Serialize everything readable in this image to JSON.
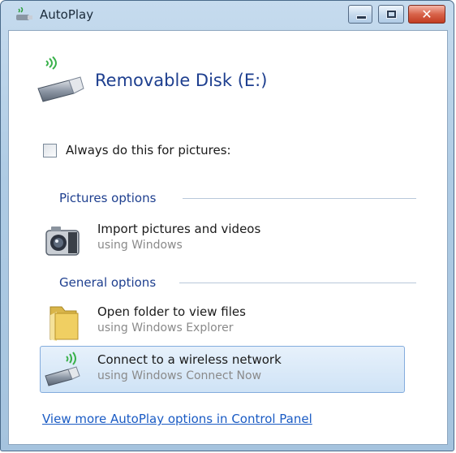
{
  "window": {
    "title": "AutoPlay",
    "controls": {
      "minimize_icon": "minimize-icon",
      "maximize_icon": "maximize-icon",
      "close_glyph": "✕"
    }
  },
  "device": {
    "name": "Removable Disk (E:)",
    "icon": "usb-wireless-drive-icon"
  },
  "always_checkbox": {
    "label": "Always do this for pictures:",
    "checked": false
  },
  "sections": {
    "pictures": {
      "label": "Pictures options",
      "options": [
        {
          "title": "Import pictures and videos",
          "subtitle": "using Windows",
          "icon": "camera-icon"
        }
      ]
    },
    "general": {
      "label": "General options",
      "options": [
        {
          "title": "Open folder to view files",
          "subtitle": "using Windows Explorer",
          "icon": "folder-icon"
        },
        {
          "title": "Connect to a wireless network",
          "subtitle": "using Windows Connect Now",
          "icon": "wireless-usb-icon",
          "selected": true
        }
      ]
    }
  },
  "footer_link": "View more AutoPlay options in Control Panel",
  "colors": {
    "accent_text": "#1e3f8f",
    "link": "#1a5bc4",
    "selection": "#cfe3f6"
  }
}
